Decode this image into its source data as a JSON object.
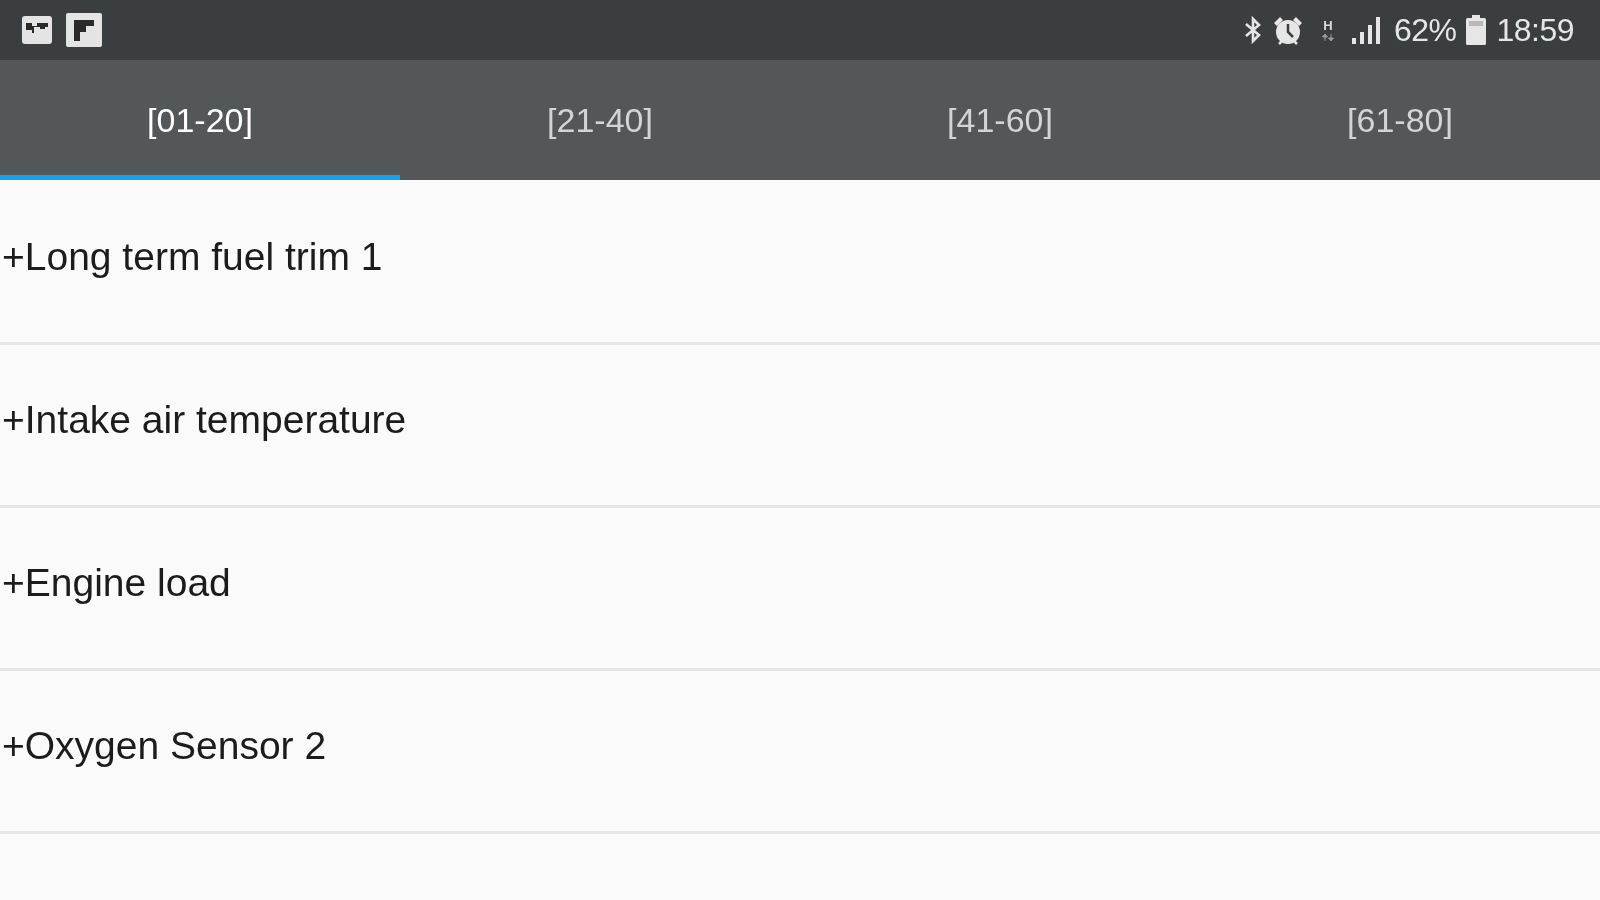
{
  "status_bar": {
    "network_type": "H",
    "battery": "62%",
    "time": "18:59"
  },
  "tabs": [
    {
      "label": "[01-20]",
      "selected": true
    },
    {
      "label": "[21-40]",
      "selected": false
    },
    {
      "label": "[41-60]",
      "selected": false
    },
    {
      "label": "[61-80]",
      "selected": false
    }
  ],
  "rows": [
    {
      "label": "+Long term fuel trim 1"
    },
    {
      "label": "+Intake air temperature"
    },
    {
      "label": "+Engine load"
    },
    {
      "label": "+Oxygen Sensor 2"
    }
  ]
}
